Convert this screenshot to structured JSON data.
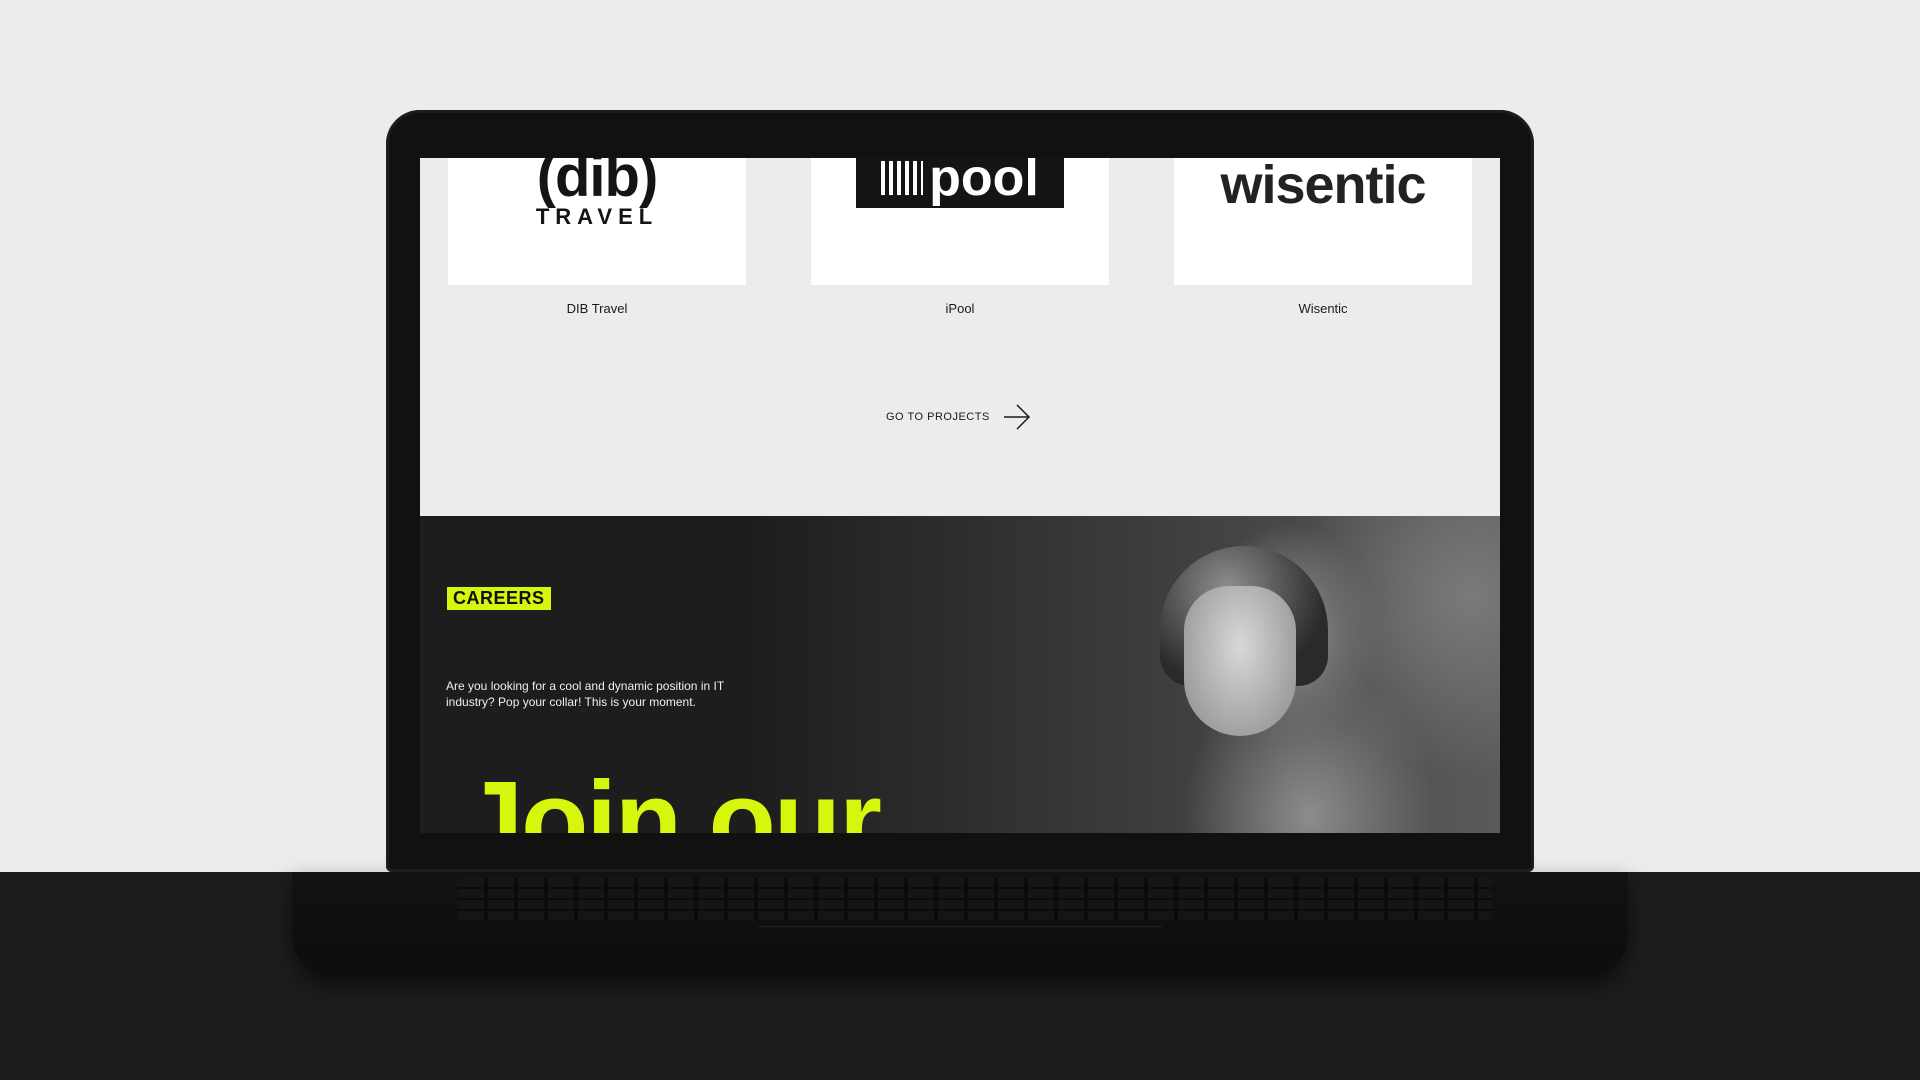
{
  "projects": {
    "cards": [
      {
        "logo_main": "(dib)",
        "logo_sub": "TRAVEL",
        "label": "DIB Travel"
      },
      {
        "logo_main": "pool",
        "label": "iPool"
      },
      {
        "logo_main": "wisentic",
        "label": "Wisentic"
      }
    ],
    "go_to_projects": "GO TO PROJECTS"
  },
  "careers": {
    "badge": "CAREERS",
    "description": "Are you looking for a cool and dynamic position in IT industry? Pop your collar! This is your moment.",
    "headline": "Join our"
  },
  "colors": {
    "accent": "#d6f70d",
    "dark_section": "#1d1d1d",
    "light_section": "#ececec"
  },
  "icons": {
    "go_arrow": "arrow-right-icon"
  }
}
